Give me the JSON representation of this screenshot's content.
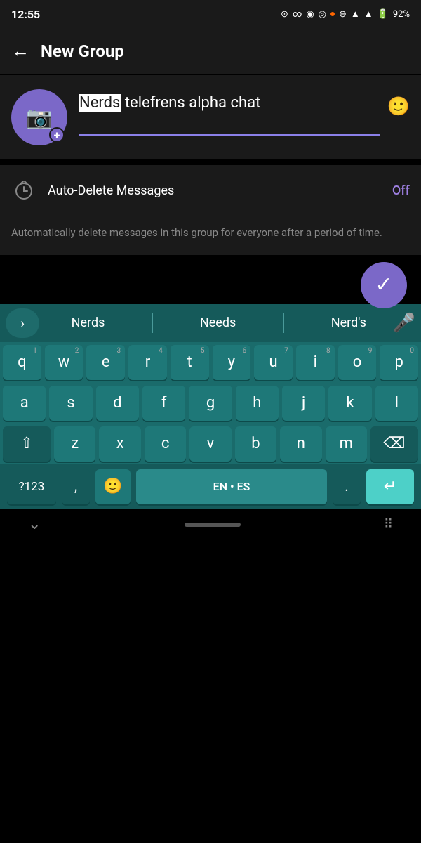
{
  "statusBar": {
    "time": "12:55",
    "batteryPercent": "92%",
    "icons": [
      "camera",
      "voicemail",
      "audio",
      "record"
    ]
  },
  "toolbar": {
    "backLabel": "←",
    "title": "New Group"
  },
  "groupInfo": {
    "groupName": "Nerds",
    "groupNameCursor": "Nerds",
    "groupNameRest": " telefrens alpha\nchat",
    "emojiIconLabel": "🙂"
  },
  "autoDelete": {
    "label": "Auto-Delete Messages",
    "value": "Off",
    "description": "Automatically delete messages in this group for everyone after a period of time."
  },
  "fab": {
    "checkIcon": "✓"
  },
  "keyboard": {
    "suggestions": [
      "Nerds",
      "Needs",
      "Nerd's"
    ],
    "rows": [
      [
        "q",
        "w",
        "e",
        "r",
        "t",
        "y",
        "u",
        "i",
        "o",
        "p"
      ],
      [
        "a",
        "s",
        "d",
        "f",
        "g",
        "h",
        "j",
        "k",
        "l"
      ],
      [
        "z",
        "x",
        "c",
        "v",
        "b",
        "n",
        "m"
      ]
    ],
    "numbers": [
      "1",
      "2",
      "3",
      "4",
      "5",
      "6",
      "7",
      "8",
      "9",
      "0"
    ],
    "bottomLeft": "?123",
    "spaceLabel": "EN • ES",
    "enterIcon": "↵"
  }
}
